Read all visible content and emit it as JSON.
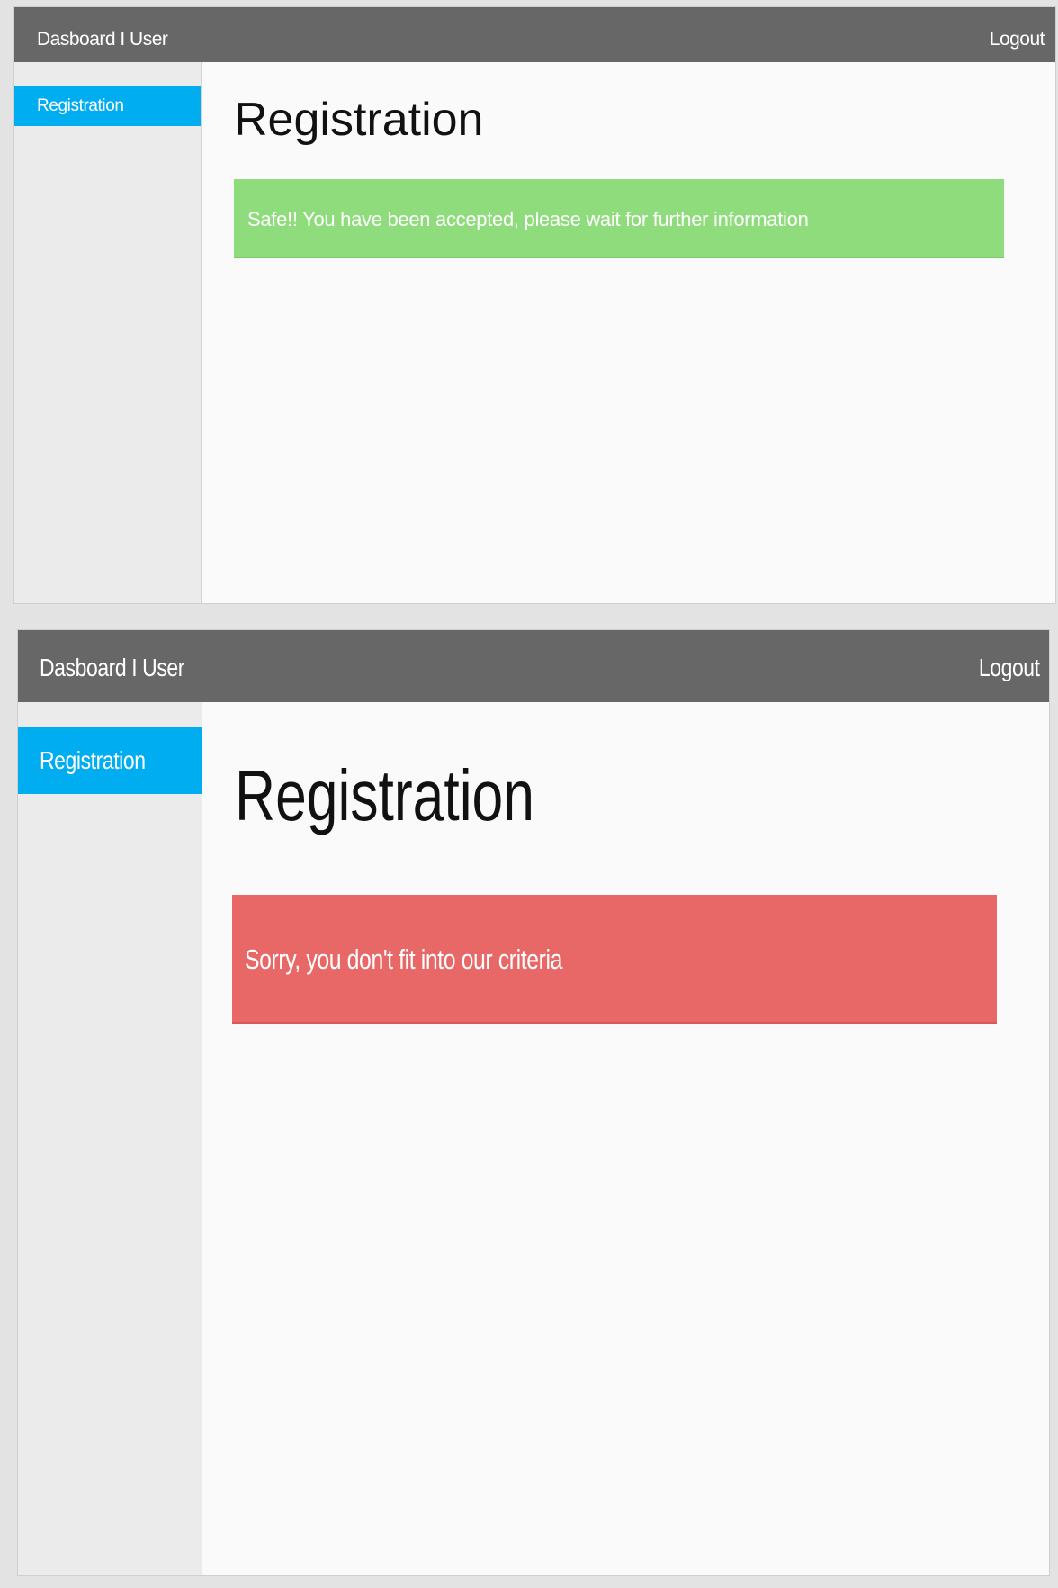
{
  "screens": [
    {
      "header": {
        "brand": "Dasboard I User",
        "logout_label": "Logout"
      },
      "sidebar": {
        "items": [
          {
            "label": "Registration",
            "active": true
          }
        ]
      },
      "main": {
        "title": "Registration",
        "alert": {
          "type": "success",
          "message": "Safe!! You have been accepted, please wait for further information"
        }
      }
    },
    {
      "header": {
        "brand": "Dasboard I User",
        "logout_label": "Logout"
      },
      "sidebar": {
        "items": [
          {
            "label": "Registration",
            "active": true
          }
        ]
      },
      "main": {
        "title": "Registration",
        "alert": {
          "type": "error",
          "message": "Sorry, you don't fit into our criteria"
        }
      }
    }
  ],
  "colors": {
    "header_bg": "#676767",
    "nav_active_bg": "#00adf1",
    "sidebar_bg": "#ebebeb",
    "success_bg": "#8fdc7d",
    "error_bg": "#e86868",
    "page_bg": "#fafafa"
  }
}
